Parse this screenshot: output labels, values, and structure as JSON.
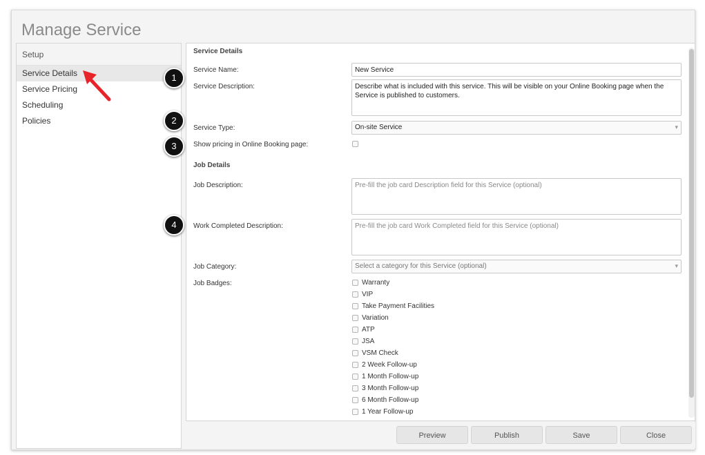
{
  "window": {
    "title": "Manage Service"
  },
  "sidebar": {
    "header": "Setup",
    "items": [
      {
        "label": "Service Details",
        "active": true
      },
      {
        "label": "Service Pricing"
      },
      {
        "label": "Scheduling"
      },
      {
        "label": "Policies"
      }
    ]
  },
  "service_details": {
    "section_title": "Service Details",
    "name_label": "Service Name:",
    "name_value": "New Service",
    "description_label": "Service Description:",
    "description_value": "Describe what is included with this service. This will be visible on your Online Booking page when the Service is published to customers.",
    "type_label": "Service Type:",
    "type_value": "On-site Service",
    "show_pricing_label": "Show pricing in Online Booking page:",
    "show_pricing_checked": false
  },
  "job_details": {
    "section_title": "Job Details",
    "description_label": "Job Description:",
    "description_placeholder": "Pre-fill the job card Description field for this Service (optional)",
    "work_completed_label": "Work Completed Description:",
    "work_completed_placeholder": "Pre-fill the job card Work Completed field for this Service (optional)",
    "category_label": "Job Category:",
    "category_placeholder": "Select a category for this Service (optional)",
    "badges_label": "Job Badges:",
    "badges": [
      "Warranty",
      "VIP",
      "Take Payment Facilities",
      "Variation",
      "ATP",
      "JSA",
      "VSM Check",
      "2 Week Follow-up",
      "1 Month Follow-up",
      "3 Month Follow-up",
      "6 Month Follow-up",
      "1 Year Follow-up"
    ]
  },
  "footer": {
    "preview_label": "Preview",
    "publish_label": "Publish",
    "save_label": "Save",
    "close_label": "Close"
  },
  "callouts": [
    "1",
    "2",
    "3",
    "4"
  ],
  "colors": {
    "arrow": "#e8242b",
    "callout_bg": "#111111"
  },
  "icons": {
    "chevron": "chevron-down-icon",
    "pointer": "red-arrow-icon"
  }
}
